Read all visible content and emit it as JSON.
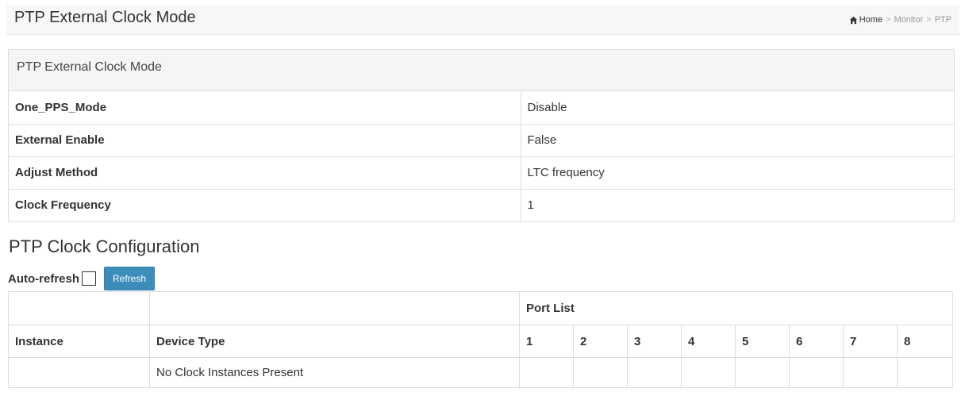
{
  "header": {
    "title": "PTP External Clock Mode",
    "breadcrumb": {
      "home": "Home",
      "sep1": ">",
      "monitor": "Monitor",
      "sep2": ">",
      "current": "PTP"
    }
  },
  "external_clock": {
    "heading": "PTP External Clock Mode",
    "rows": [
      {
        "label": "One_PPS_Mode",
        "value": "Disable"
      },
      {
        "label": "External Enable",
        "value": "False"
      },
      {
        "label": "Adjust Method",
        "value": "LTC frequency"
      },
      {
        "label": "Clock Frequency",
        "value": "1"
      }
    ]
  },
  "clock_config": {
    "title": "PTP Clock Configuration",
    "auto_refresh_label": "Auto-refresh",
    "auto_refresh_checked": false,
    "refresh_button": "Refresh",
    "table": {
      "port_list_header": "Port List",
      "instance_header": "Instance",
      "device_type_header": "Device Type",
      "ports": [
        "1",
        "2",
        "3",
        "4",
        "5",
        "6",
        "7",
        "8"
      ],
      "empty_message": "No Clock Instances Present"
    }
  },
  "colors": {
    "accent": "#3c8dbc",
    "border": "#dddddd",
    "header_bg": "#f7f7f7"
  },
  "icons": {
    "home": "home-icon"
  }
}
